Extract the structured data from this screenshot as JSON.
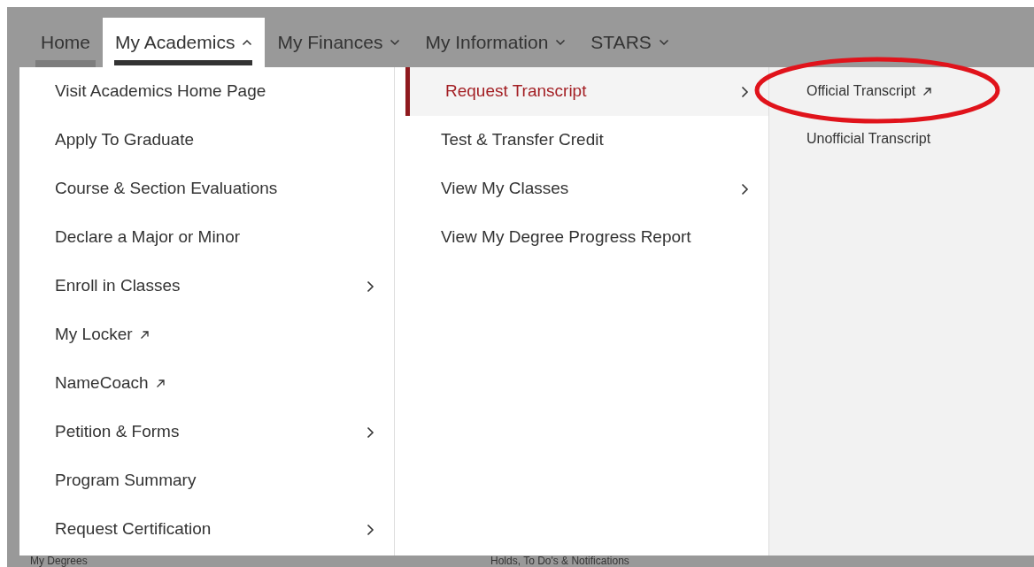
{
  "nav": [
    {
      "label": "Home",
      "has_menu": false,
      "selected": false,
      "current": true
    },
    {
      "label": "My Academics",
      "has_menu": true,
      "expanded": true,
      "selected": true,
      "current": false
    },
    {
      "label": "My Finances",
      "has_menu": true,
      "expanded": false,
      "selected": false,
      "current": false
    },
    {
      "label": "My Information",
      "has_menu": true,
      "expanded": false,
      "selected": false,
      "current": false
    },
    {
      "label": "STARS",
      "has_menu": true,
      "expanded": false,
      "selected": false,
      "current": false
    }
  ],
  "menu_columns": [
    {
      "items": [
        {
          "label": "Visit Academics Home Page",
          "kind": "link",
          "selected": false
        },
        {
          "label": "Apply To Graduate",
          "kind": "link",
          "selected": false
        },
        {
          "label": "Course & Section Evaluations",
          "kind": "link",
          "selected": false
        },
        {
          "label": "Declare a Major or Minor",
          "kind": "link",
          "selected": false
        },
        {
          "label": "Enroll in Classes",
          "kind": "submenu",
          "selected": false
        },
        {
          "label": "My Locker",
          "kind": "external",
          "selected": false
        },
        {
          "label": "NameCoach",
          "kind": "external",
          "selected": false
        },
        {
          "label": "Petition & Forms",
          "kind": "submenu",
          "selected": false
        },
        {
          "label": "Program Summary",
          "kind": "link",
          "selected": false
        },
        {
          "label": "Request Certification",
          "kind": "submenu",
          "selected": false
        }
      ]
    },
    {
      "items": [
        {
          "label": "Request Transcript",
          "kind": "submenu",
          "selected": true
        },
        {
          "label": "Test & Transfer Credit",
          "kind": "link",
          "selected": false
        },
        {
          "label": "View My Classes",
          "kind": "submenu",
          "selected": false
        },
        {
          "label": "View My Degree Progress Report",
          "kind": "link",
          "selected": false
        }
      ]
    },
    {
      "items": [
        {
          "label": "Official Transcript",
          "kind": "external",
          "selected": false,
          "circled": true
        },
        {
          "label": "Unofficial Transcript",
          "kind": "link",
          "selected": false,
          "circled": false
        }
      ]
    }
  ],
  "page_headings": [
    "My Degrees",
    "Holds, To Do's & Notifications"
  ]
}
